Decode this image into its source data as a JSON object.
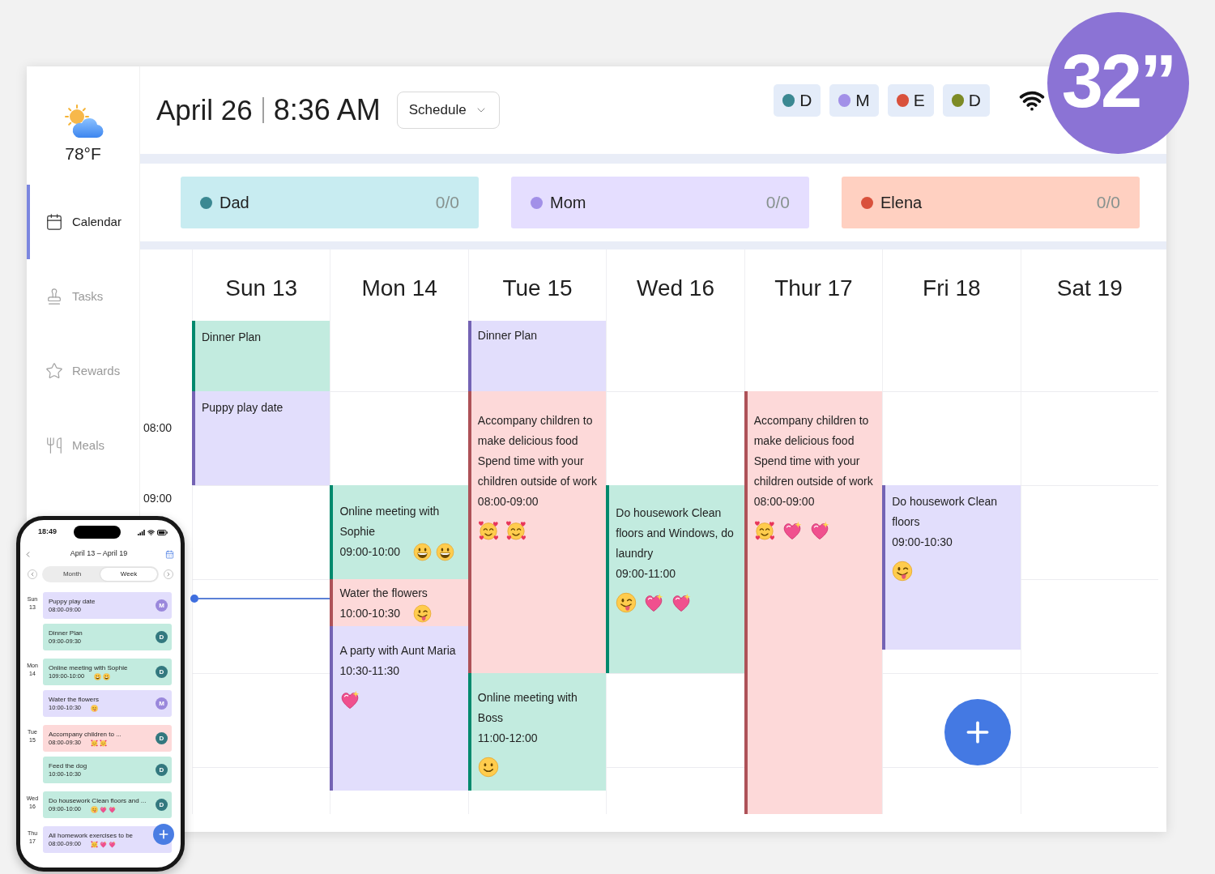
{
  "sidebar": {
    "weather": {
      "temperature": "78°F"
    },
    "items": [
      {
        "label": "Calendar",
        "selected": true,
        "kind": "calendar"
      },
      {
        "label": "Tasks",
        "selected": false,
        "kind": "tasks"
      },
      {
        "label": "Rewards",
        "selected": false,
        "kind": "rewards"
      },
      {
        "label": "Meals",
        "selected": false,
        "kind": "meals"
      }
    ]
  },
  "header": {
    "date": "April 26",
    "time": "8:36 AM",
    "view_select": {
      "value": "Schedule"
    },
    "members": [
      {
        "initial": "D",
        "color": "#3b8892"
      },
      {
        "initial": "M",
        "color": "#a290e8"
      },
      {
        "initial": "E",
        "color": "#d9513c"
      },
      {
        "initial": "D",
        "color": "#7d8b25"
      }
    ]
  },
  "size_badge": {
    "label": "32”"
  },
  "member_cards": [
    {
      "name": "Dad",
      "count": "0/0",
      "color": "#3b8892"
    },
    {
      "name": "Mom",
      "count": "0/0",
      "color": "#a290e8"
    },
    {
      "name": "Elena",
      "count": "0/0",
      "color": "#d9513c"
    }
  ],
  "calendar": {
    "time_labels": [
      "08:00",
      "09:00"
    ],
    "days": [
      {
        "label": "Sun 13",
        "events": [
          {
            "title": "Dinner Plan",
            "color": "#c2ebdf"
          },
          {
            "title": "Puppy play date",
            "color": "#e2defc"
          }
        ]
      },
      {
        "label": "Mon 14",
        "events": [
          {
            "title": "Online meeting with Sophie",
            "time": "09:00-10:00",
            "stickers": [
              {
                "kind": "grin"
              },
              {
                "kind": "grin"
              }
            ],
            "color": "#c2ebdf"
          },
          {
            "title": "Water the flowers",
            "time": "10:00-10:30",
            "stickers": [
              {
                "kind": "wink-tongue"
              }
            ],
            "color": "#fdd9d9"
          },
          {
            "title": "A party with Aunt Maria",
            "time": "10:30-11:30",
            "stickers": [
              {
                "kind": "sparkling-heart"
              }
            ],
            "color": "#e2defc"
          }
        ]
      },
      {
        "label": "Tue 15",
        "events": [
          {
            "title": "Dinner Plan",
            "color": "#e2defc"
          },
          {
            "title": "Accompany children to make delicious food Spend time with your children outside of work",
            "time": "08:00-09:00",
            "stickers": [
              {
                "kind": "hearts-face"
              },
              {
                "kind": "hearts-face"
              }
            ],
            "color": "#fdd9d9"
          },
          {
            "title": "Online meeting with Boss",
            "time": "11:00-12:00",
            "stickers": [
              {
                "kind": "smile"
              }
            ],
            "color": "#c2ebdf"
          }
        ]
      },
      {
        "label": "Wed 16",
        "events": [
          {
            "title": "Do housework Clean floors and Windows, do laundry",
            "time": "09:00-11:00",
            "stickers": [
              {
                "kind": "wink-tongue"
              },
              {
                "kind": "sparkling-heart"
              },
              {
                "kind": "sparkling-heart"
              }
            ],
            "color": "#c2ebdf"
          }
        ]
      },
      {
        "label": "Thur 17",
        "events": [
          {
            "title": "Accompany children to make delicious food Spend time with your children outside of work",
            "time": "08:00-09:00",
            "stickers": [
              {
                "kind": "hearts-face"
              },
              {
                "kind": "sparkling-heart"
              },
              {
                "kind": "sparkling-heart"
              }
            ],
            "color": "#fdd9d9"
          }
        ]
      },
      {
        "label": "Fri 18",
        "events": [
          {
            "title": "Do housework Clean floors",
            "time": "09:00-10:30",
            "stickers": [
              {
                "kind": "wink-tongue"
              }
            ],
            "color": "#e2defc"
          }
        ]
      },
      {
        "label": "Sat 19"
      }
    ]
  },
  "phone": {
    "status_time": "18:49",
    "title": "April 13 – April 19",
    "view_tabs": [
      {
        "label": "Month",
        "selected": false
      },
      {
        "label": "Week",
        "selected": true
      }
    ],
    "days": [
      {
        "weekday": "Sun",
        "date": "13",
        "events": [
          {
            "title": "Puppy play date",
            "time": "08:00-09:00",
            "color": "#e2defc",
            "avatar": {
              "initial": "M",
              "color": "#9a88dc"
            }
          },
          {
            "title": "Dinner Plan",
            "time": "09:00-09:30",
            "color": "#c2ebdf",
            "avatar": {
              "initial": "D",
              "color": "#33787f"
            }
          }
        ]
      },
      {
        "weekday": "Mon",
        "date": "14",
        "events": [
          {
            "title": "Online meeting with Sophie",
            "time": "109:00-10:00",
            "stickers": [
              {
                "kind": "grin"
              },
              {
                "kind": "grin"
              }
            ],
            "color": "#c2ebdf",
            "avatar": {
              "initial": "D",
              "color": "#33787f"
            }
          },
          {
            "title": "Water the flowers",
            "time": "10:00-10:30",
            "stickers": [
              {
                "kind": "wink-tongue"
              }
            ],
            "color": "#e2defc",
            "avatar": {
              "initial": "M",
              "color": "#9a88dc"
            }
          }
        ]
      },
      {
        "weekday": "Tue",
        "date": "15",
        "events": [
          {
            "title": "Accompany children to ...",
            "time": "08:00-09:30",
            "stickers": [
              {
                "kind": "hearts-face"
              },
              {
                "kind": "hearts-face"
              }
            ],
            "color": "#fdd9d9",
            "avatar": {
              "initial": "D",
              "color": "#33787f"
            }
          },
          {
            "title": "Feed the dog",
            "time": "10:00-10:30",
            "color": "#c2ebdf",
            "avatar": {
              "initial": "D",
              "color": "#33787f"
            }
          }
        ]
      },
      {
        "weekday": "Wed",
        "date": "16",
        "events": [
          {
            "title": "Do housework Clean floors and ...",
            "time": "09:00-10:00",
            "stickers": [
              {
                "kind": "wink-tongue"
              },
              {
                "kind": "sparkling-heart"
              },
              {
                "kind": "sparkling-heart"
              }
            ],
            "color": "#c2ebdf",
            "avatar": {
              "initial": "D",
              "color": "#33787f"
            }
          }
        ]
      },
      {
        "weekday": "Thu",
        "date": "17",
        "events": [
          {
            "title": "All homework exercises to be",
            "time": "08:00-09:00",
            "stickers": [
              {
                "kind": "hearts-face"
              },
              {
                "kind": "sparkling-heart"
              },
              {
                "kind": "sparkling-heart"
              }
            ],
            "color": "#e2defc"
          }
        ]
      }
    ]
  }
}
